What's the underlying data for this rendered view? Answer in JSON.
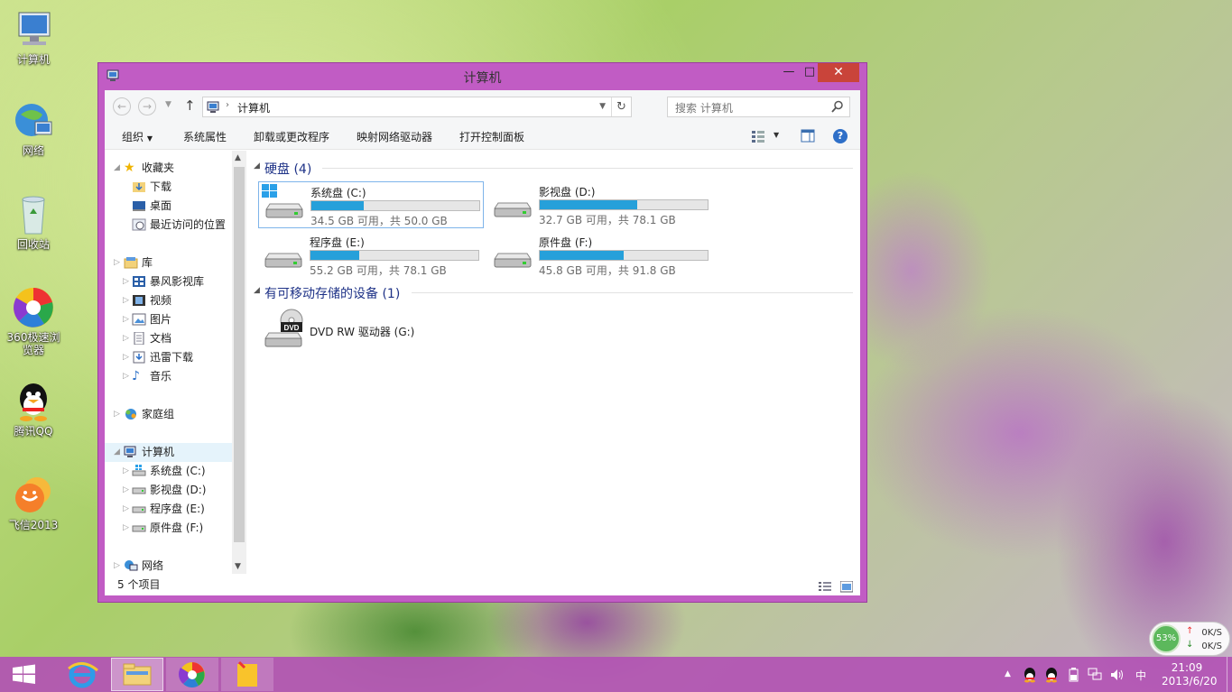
{
  "desktop": {
    "icons": [
      {
        "label": "计算机",
        "icon": "computer-icon"
      },
      {
        "label": "网络",
        "icon": "network-icon"
      },
      {
        "label": "回收站",
        "icon": "recycle-bin-icon"
      },
      {
        "label": "360极速浏览器",
        "icon": "360-browser-icon"
      },
      {
        "label": "腾讯QQ",
        "icon": "qq-icon"
      },
      {
        "label": "飞信2013",
        "icon": "fetion-icon"
      }
    ]
  },
  "window": {
    "title": "计算机",
    "controls": {
      "minimize": "—",
      "maximize": "□",
      "close": "✕"
    }
  },
  "address": {
    "path": "计算机",
    "search_placeholder": "搜索 计算机"
  },
  "toolbar": {
    "organize": "组织",
    "system_properties": "系统属性",
    "uninstall": "卸载或更改程序",
    "map_drive": "映射网络驱动器",
    "control_panel": "打开控制面板"
  },
  "nav": {
    "favorites": {
      "label": "收藏夹",
      "items": [
        "下载",
        "桌面",
        "最近访问的位置"
      ]
    },
    "libraries": {
      "label": "库",
      "items": [
        "暴风影视库",
        "视频",
        "图片",
        "文档",
        "迅雷下载",
        "音乐"
      ]
    },
    "homegroup": "家庭组",
    "computer": {
      "label": "计算机",
      "items": [
        "系统盘 (C:)",
        "影视盘 (D:)",
        "程序盘 (E:)",
        "原件盘 (F:)"
      ]
    },
    "network": "网络"
  },
  "content": {
    "hdd_group": "硬盘 (4)",
    "drives": [
      {
        "name": "系统盘 (C:)",
        "free": "34.5 GB 可用，共 50.0 GB",
        "used_fraction": 0.31
      },
      {
        "name": "影视盘 (D:)",
        "free": "32.7 GB 可用，共 78.1 GB",
        "used_fraction": 0.58
      },
      {
        "name": "程序盘 (E:)",
        "free": "55.2 GB 可用，共 78.1 GB",
        "used_fraction": 0.29
      },
      {
        "name": "原件盘 (F:)",
        "free": "45.8 GB 可用，共 91.8 GB",
        "used_fraction": 0.5
      }
    ],
    "removable_group": "有可移动存储的设备 (1)",
    "dvd": {
      "name": "DVD RW 驱动器 (G:)",
      "icon_text": "DVD"
    }
  },
  "status": {
    "items": "5 个项目"
  },
  "netwidget": {
    "percent": "53%",
    "up": "0K/S",
    "down": "0K/S"
  },
  "taskbar": {
    "ime": "中",
    "time": "21:09",
    "date": "2013/6/20"
  },
  "colors": {
    "accent": "#c15cc4",
    "bar_fill": "#26a0da",
    "close": "#c9443a"
  }
}
